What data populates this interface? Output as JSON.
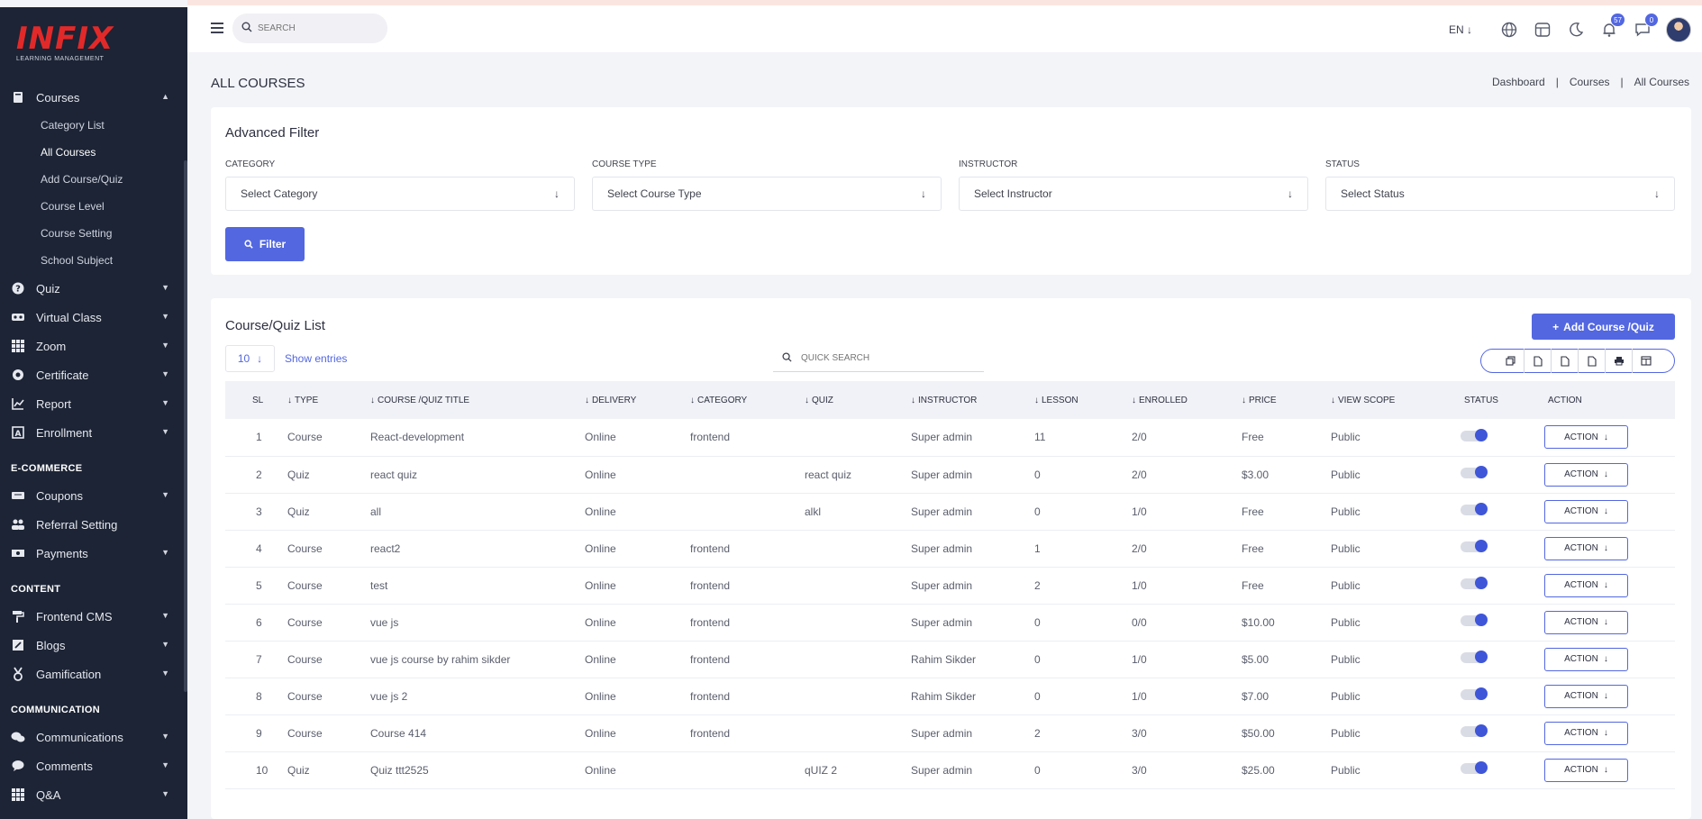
{
  "brand": {
    "logo_text": "INFIX",
    "logo_sub": "LEARNING MANAGEMENT"
  },
  "sidebar": {
    "courses_label": "Courses",
    "courses_sub": [
      "Category List",
      "All Courses",
      "Add Course/Quiz",
      "Course Level",
      "Course Setting",
      "School Subject"
    ],
    "items_a": [
      {
        "label": "Quiz",
        "icon": "question-circle-icon"
      },
      {
        "label": "Virtual Class",
        "icon": "vr-headset-icon"
      },
      {
        "label": "Zoom",
        "icon": "grid-icon"
      },
      {
        "label": "Certificate",
        "icon": "badge-icon"
      },
      {
        "label": "Report",
        "icon": "chart-icon"
      },
      {
        "label": "Enrollment",
        "icon": "enroll-icon"
      }
    ],
    "section_ecommerce": "E-COMMERCE",
    "items_b": [
      {
        "label": "Coupons",
        "icon": "ticket-icon",
        "caret": true
      },
      {
        "label": "Referral Setting",
        "icon": "users-icon",
        "caret": false
      },
      {
        "label": "Payments",
        "icon": "money-icon",
        "caret": true
      }
    ],
    "section_content": "CONTENT",
    "items_c": [
      {
        "label": "Frontend CMS",
        "icon": "paint-roller-icon"
      },
      {
        "label": "Blogs",
        "icon": "pen-icon"
      },
      {
        "label": "Gamification",
        "icon": "medal-icon"
      }
    ],
    "section_communication": "COMMUNICATION",
    "items_d": [
      {
        "label": "Communications",
        "icon": "chat-icon"
      },
      {
        "label": "Comments",
        "icon": "comment-icon"
      },
      {
        "label": "Q&A",
        "icon": "grid-icon"
      }
    ]
  },
  "topbar": {
    "search_placeholder": "SEARCH",
    "lang": "EN ↓",
    "notifications_count": "57",
    "messages_count": "0"
  },
  "page": {
    "title": "ALL COURSES",
    "breadcrumb": [
      "Dashboard",
      "Courses",
      "All Courses"
    ]
  },
  "filter": {
    "title": "Advanced Filter",
    "category_label": "CATEGORY",
    "category_value": "Select Category",
    "type_label": "COURSE TYPE",
    "type_value": "Select Course Type",
    "instructor_label": "INSTRUCTOR",
    "instructor_value": "Select Instructor",
    "status_label": "STATUS",
    "status_value": "Select Status",
    "button": "Filter"
  },
  "list": {
    "title": "Course/Quiz List",
    "add_button": "Add Course /Quiz",
    "entries_value": "10",
    "entries_label": "Show entries",
    "quick_search_placeholder": "QUICK SEARCH",
    "columns": [
      "SL",
      "TYPE",
      "COURSE /QUIZ TITLE",
      "DELIVERY",
      "CATEGORY",
      "QUIZ",
      "INSTRUCTOR",
      "LESSON",
      "ENROLLED",
      "PRICE",
      "VIEW SCOPE",
      "STATUS",
      "ACTION"
    ],
    "action_label": "ACTION",
    "rows": [
      {
        "sl": "1",
        "type": "Course",
        "title": "React-development",
        "delivery": "Online",
        "category": "frontend",
        "quiz": "",
        "instructor": "Super admin",
        "lesson": "11",
        "enrolled": "2/0",
        "price": "Free",
        "scope": "Public"
      },
      {
        "sl": "2",
        "type": "Quiz",
        "title": "react quiz",
        "delivery": "Online",
        "category": "",
        "quiz": "react quiz",
        "instructor": "Super admin",
        "lesson": "0",
        "enrolled": "2/0",
        "price": "$3.00",
        "scope": "Public"
      },
      {
        "sl": "3",
        "type": "Quiz",
        "title": "all",
        "delivery": "Online",
        "category": "",
        "quiz": "alkl",
        "instructor": "Super admin",
        "lesson": "0",
        "enrolled": "1/0",
        "price": "Free",
        "scope": "Public"
      },
      {
        "sl": "4",
        "type": "Course",
        "title": "react2",
        "delivery": "Online",
        "category": "frontend",
        "quiz": "",
        "instructor": "Super admin",
        "lesson": "1",
        "enrolled": "2/0",
        "price": "Free",
        "scope": "Public"
      },
      {
        "sl": "5",
        "type": "Course",
        "title": "test",
        "delivery": "Online",
        "category": "frontend",
        "quiz": "",
        "instructor": "Super admin",
        "lesson": "2",
        "enrolled": "1/0",
        "price": "Free",
        "scope": "Public"
      },
      {
        "sl": "6",
        "type": "Course",
        "title": "vue js",
        "delivery": "Online",
        "category": "frontend",
        "quiz": "",
        "instructor": "Super admin",
        "lesson": "0",
        "enrolled": "0/0",
        "price": "$10.00",
        "scope": "Public"
      },
      {
        "sl": "7",
        "type": "Course",
        "title": "vue js course by rahim sikder",
        "delivery": "Online",
        "category": "frontend",
        "quiz": "",
        "instructor": "Rahim Sikder",
        "lesson": "0",
        "enrolled": "1/0",
        "price": "$5.00",
        "scope": "Public"
      },
      {
        "sl": "8",
        "type": "Course",
        "title": "vue js 2",
        "delivery": "Online",
        "category": "frontend",
        "quiz": "",
        "instructor": "Rahim Sikder",
        "lesson": "0",
        "enrolled": "1/0",
        "price": "$7.00",
        "scope": "Public"
      },
      {
        "sl": "9",
        "type": "Course",
        "title": "Course 414",
        "delivery": "Online",
        "category": "frontend",
        "quiz": "",
        "instructor": "Super admin",
        "lesson": "2",
        "enrolled": "3/0",
        "price": "$50.00",
        "scope": "Public"
      },
      {
        "sl": "10",
        "type": "Quiz",
        "title": "Quiz ttt2525",
        "delivery": "Online",
        "category": "",
        "quiz": "qUIZ 2",
        "instructor": "Super admin",
        "lesson": "0",
        "enrolled": "3/0",
        "price": "$25.00",
        "scope": "Public"
      }
    ]
  },
  "colors": {
    "accent": "#5367e0",
    "sidebar_bg": "#1c2435",
    "brand_red": "#e22929"
  }
}
